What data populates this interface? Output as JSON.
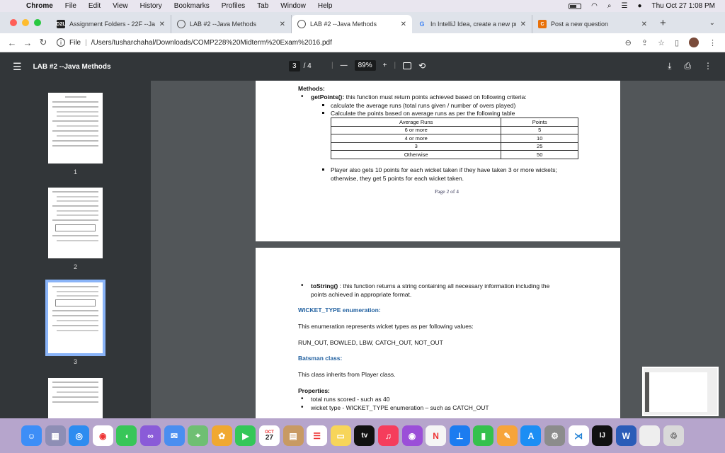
{
  "menubar": {
    "app": "Chrome",
    "items": [
      "File",
      "Edit",
      "View",
      "History",
      "Bookmarks",
      "Profiles",
      "Tab",
      "Window",
      "Help"
    ],
    "clock": "Thu Oct 27  1:08 PM"
  },
  "tabs": [
    {
      "title": "Assignment Folders - 22F --Ja",
      "favicon": "D2L",
      "color": "#222"
    },
    {
      "title": "LAB #2 --Java Methods",
      "favicon": "globe",
      "color": "#555"
    },
    {
      "title": "LAB #2 --Java Methods",
      "favicon": "globe",
      "color": "#555",
      "active": true
    },
    {
      "title": "In IntelliJ Idea, create a new pr",
      "favicon": "G",
      "color": "#4285f4"
    },
    {
      "title": "Post a new question",
      "favicon": "C",
      "color": "#e8710a"
    }
  ],
  "addressbar": {
    "scheme": "File",
    "url": "/Users/tusharchahal/Downloads/COMP228%20Midterm%20Exam%2016.pdf"
  },
  "pdf": {
    "title": "LAB #2 --Java Methods",
    "current_page": "3",
    "total_pages": "/ 4",
    "zoom": "89%"
  },
  "thumbs": [
    "1",
    "2",
    "3"
  ],
  "page1": {
    "heading": "Methods:",
    "getpoints_name": "getPoints():",
    "getpoints_desc": " this function must return points achieved based on following criteria:",
    "item1": "calculate the average runs (total runs given / number of overs played)",
    "item2": "Calculate the points based on average runs as per the following table",
    "table_header": [
      "Average Runs",
      "Points"
    ],
    "table_rows": [
      [
        "6 or more",
        "5"
      ],
      [
        "4 or more",
        "10"
      ],
      [
        "3",
        "25"
      ],
      [
        "Otherwise",
        "50"
      ]
    ],
    "wicket_line1": "Player also gets 10 points for each wicket taken if they have taken 3 or more wickets;",
    "wicket_line2": "otherwise, they get 5 points for each wicket taken.",
    "footer": "Page 2 of 4"
  },
  "page2": {
    "tostring_name": "toString()",
    "tostring_line1": " : this function returns a string containing all necessary information including the",
    "tostring_line2": "points achieved in appropriate format.",
    "enum_heading": "WICKET_TYPE enumeration:",
    "enum_desc": "This enumeration represents wicket types as per following values:",
    "enum_values": "RUN_OUT, BOWLED, LBW, CATCH_OUT, NOT_OUT",
    "batsman_heading": "Batsman class:",
    "batsman_desc": "This class inherits from Player class.",
    "props_heading": "Properties:",
    "prop1": "total runs scored - such as 40",
    "prop2": "wicket type - WICKET_TYPE enumeration – such as CATCH_OUT"
  },
  "dock": {
    "calendar_month": "OCT",
    "calendar_day": "27",
    "tv": "tv"
  }
}
